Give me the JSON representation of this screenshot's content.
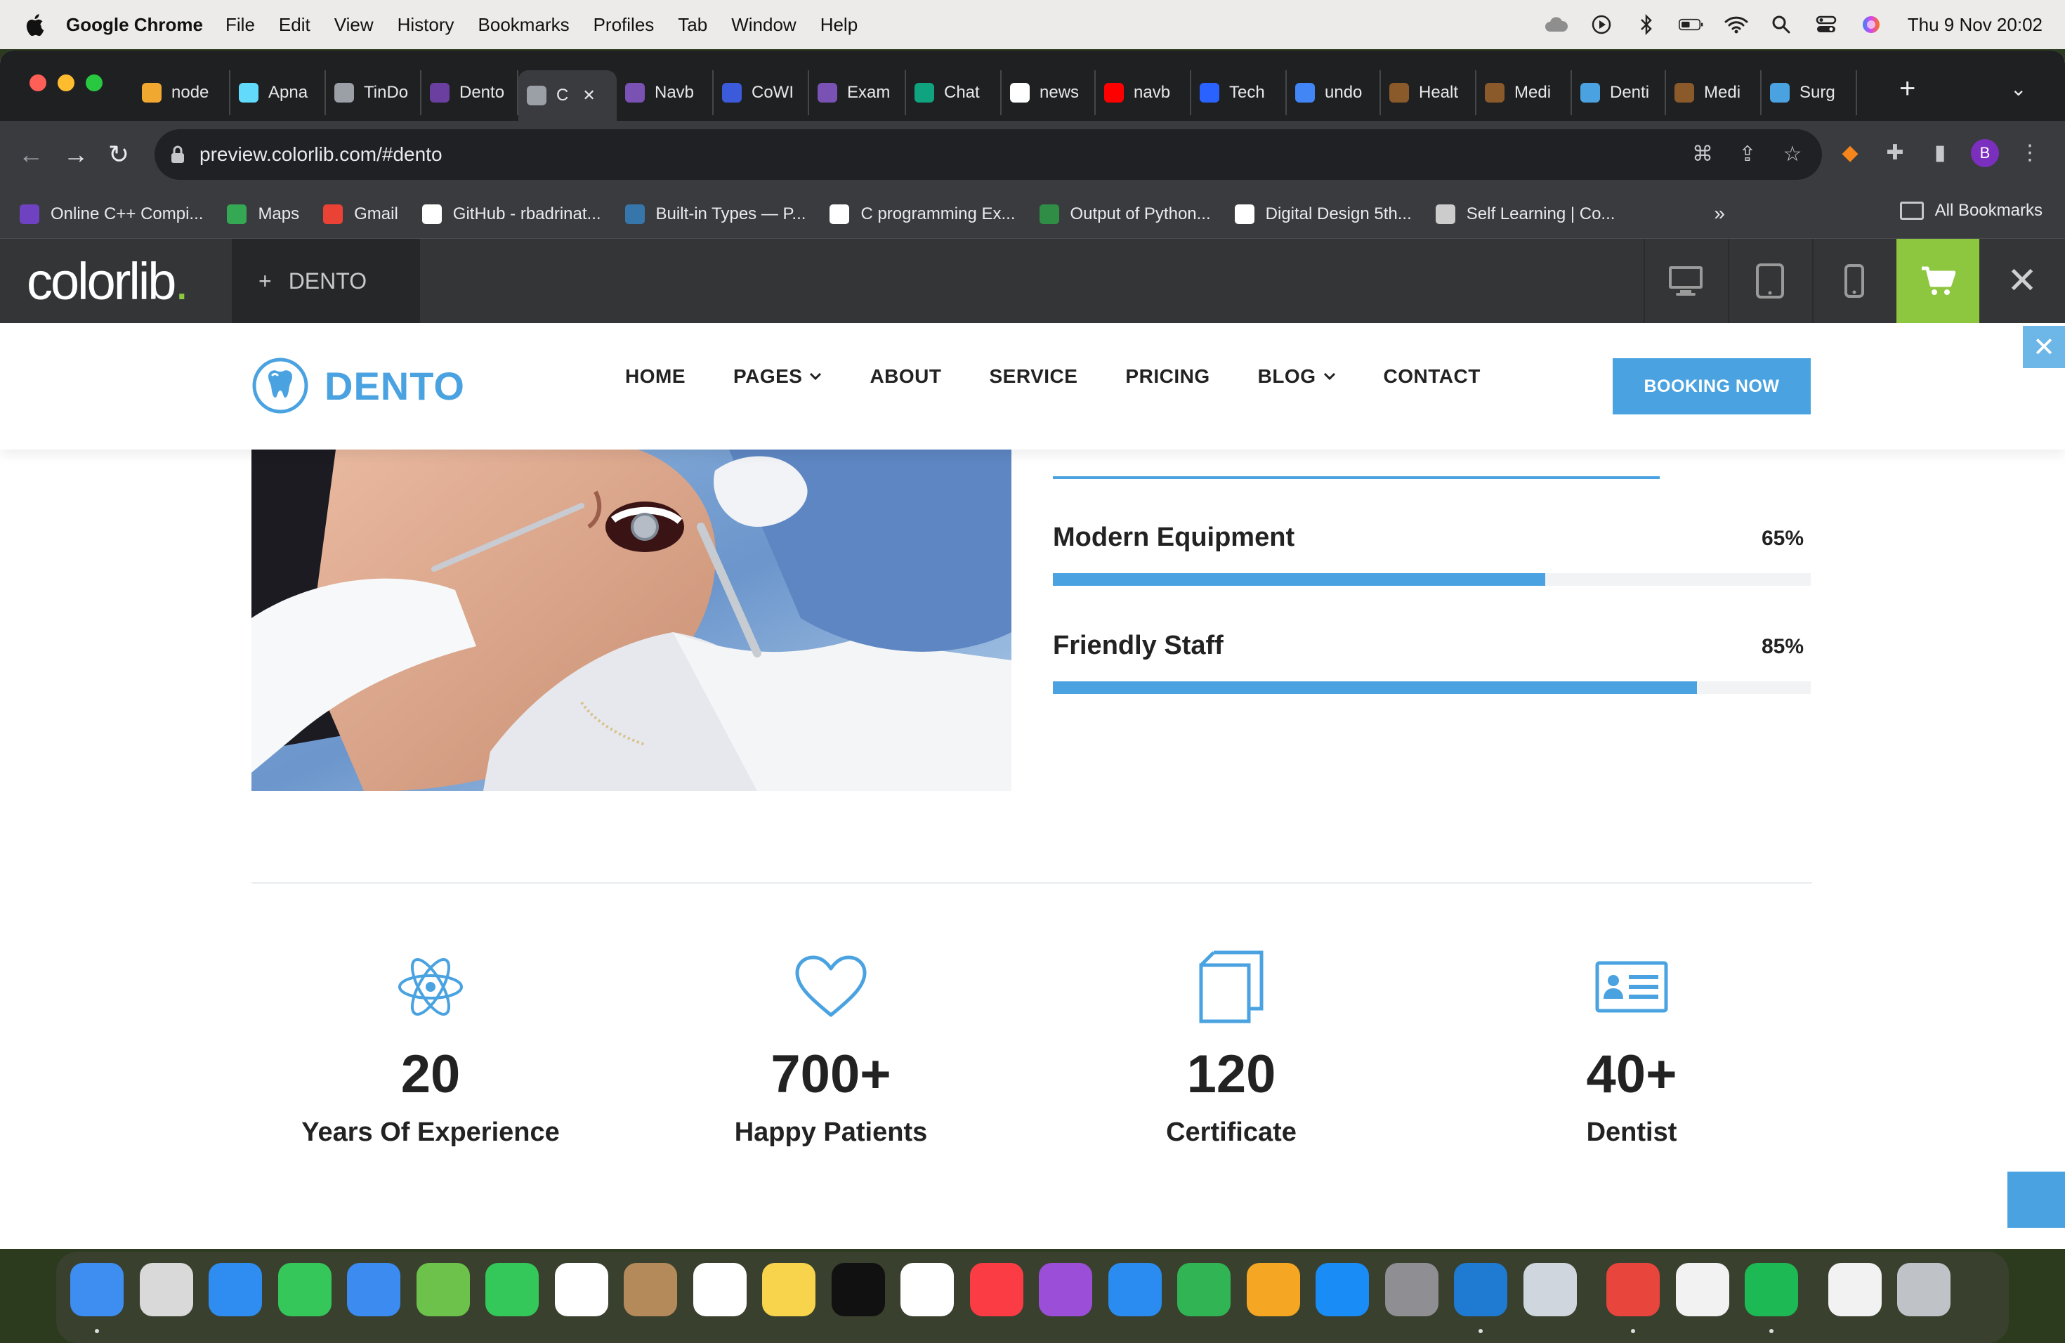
{
  "menubar": {
    "app_name": "Google Chrome",
    "items": [
      "File",
      "Edit",
      "View",
      "History",
      "Bookmarks",
      "Profiles",
      "Tab",
      "Window",
      "Help"
    ],
    "clock": "Thu 9 Nov  20:02"
  },
  "tabs": [
    {
      "title": "node",
      "color": "#f0a830"
    },
    {
      "title": "Apna",
      "color": "#61dafb"
    },
    {
      "title": "TinDo",
      "color": "#9aa0a6"
    },
    {
      "title": "Dento",
      "color": "#6b3fa0"
    },
    {
      "title": "C",
      "color": "#9aa0a6",
      "active": true
    },
    {
      "title": "Navb",
      "color": "#7952b3"
    },
    {
      "title": "CoWI",
      "color": "#3b5bdb"
    },
    {
      "title": "Exam",
      "color": "#7952b3"
    },
    {
      "title": "Chat",
      "color": "#10a37f"
    },
    {
      "title": "news",
      "color": "#ffffff"
    },
    {
      "title": "navb",
      "color": "#ff0000"
    },
    {
      "title": "Tech",
      "color": "#2962ff"
    },
    {
      "title": "undo",
      "color": "#4285f4"
    },
    {
      "title": "Healt",
      "color": "#8b5a2b"
    },
    {
      "title": "Medi",
      "color": "#8b5a2b"
    },
    {
      "title": "Denti",
      "color": "#4aa3e0"
    },
    {
      "title": "Medi",
      "color": "#8b5a2b"
    },
    {
      "title": "Surg",
      "color": "#4aa3e0"
    }
  ],
  "toolbar": {
    "url": "preview.colorlib.com/#dento",
    "avatar_letter": "B"
  },
  "bookmarks": [
    {
      "label": "Online C++ Compi...",
      "color": "#6f42c1"
    },
    {
      "label": "Maps",
      "color": "#34a853"
    },
    {
      "label": "Gmail",
      "color": "#ea4335"
    },
    {
      "label": "GitHub - rbadrinat...",
      "color": "#ffffff"
    },
    {
      "label": "Built-in Types — P...",
      "color": "#3776ab"
    },
    {
      "label": "C programming Ex...",
      "color": "#ffffff"
    },
    {
      "label": "Output of Python...",
      "color": "#2f8d46"
    },
    {
      "label": "Digital Design 5th...",
      "color": "#ffffff"
    },
    {
      "label": "Self Learning | Co...",
      "color": "#cccccc"
    }
  ],
  "bookmarks_more": "»",
  "bookmarks_all": "All Bookmarks",
  "colorlib": {
    "logo_text": "colorlib",
    "logo_dot": ".",
    "project_name": "DENTO",
    "accent": "#8dc63f"
  },
  "site": {
    "brand": "DENTO",
    "accent": "#4aa3e0",
    "nav": [
      {
        "label": "HOME",
        "dropdown": false
      },
      {
        "label": "PAGES",
        "dropdown": true
      },
      {
        "label": "ABOUT",
        "dropdown": false
      },
      {
        "label": "SERVICE",
        "dropdown": false
      },
      {
        "label": "PRICING",
        "dropdown": false
      },
      {
        "label": "BLOG",
        "dropdown": true
      },
      {
        "label": "CONTACT",
        "dropdown": false
      }
    ],
    "booking_label": "BOOKING NOW",
    "skills": [
      {
        "title": "Modern Equipment",
        "percent_label": "65%",
        "percent": 65
      },
      {
        "title": "Friendly Staff",
        "percent_label": "85%",
        "percent": 85
      }
    ],
    "stats": [
      {
        "number": "20",
        "label": "Years Of Experience",
        "icon": "atom-icon"
      },
      {
        "number": "700+",
        "label": "Happy Patients",
        "icon": "heart-icon"
      },
      {
        "number": "120",
        "label": "Certificate",
        "icon": "certificate-icon"
      },
      {
        "number": "40+",
        "label": "Dentist",
        "icon": "id-card-icon"
      }
    ]
  },
  "dock_apps": [
    {
      "name": "finder",
      "color": "#3d8ef0"
    },
    {
      "name": "launchpad",
      "color": "#d9d9d9"
    },
    {
      "name": "safari",
      "color": "#2f8cf0"
    },
    {
      "name": "messages",
      "color": "#35c759"
    },
    {
      "name": "mail",
      "color": "#3b8bf1"
    },
    {
      "name": "maps",
      "color": "#6cc24a"
    },
    {
      "name": "facetime",
      "color": "#34c759"
    },
    {
      "name": "calendar",
      "color": "#ffffff"
    },
    {
      "name": "contacts",
      "color": "#b58a5a"
    },
    {
      "name": "reminders",
      "color": "#ffffff"
    },
    {
      "name": "notes",
      "color": "#f7d44c"
    },
    {
      "name": "tv",
      "color": "#111111"
    },
    {
      "name": "photos",
      "color": "#ffffff"
    },
    {
      "name": "music",
      "color": "#fc3c44"
    },
    {
      "name": "podcasts",
      "color": "#9b4fd8"
    },
    {
      "name": "keynote",
      "color": "#2a8cf0"
    },
    {
      "name": "numbers",
      "color": "#31b454"
    },
    {
      "name": "pages",
      "color": "#f5a623"
    },
    {
      "name": "app-store",
      "color": "#1a8cf5"
    },
    {
      "name": "system-settings",
      "color": "#8e8e93"
    },
    {
      "name": "vscode",
      "color": "#1f7ad2"
    },
    {
      "name": "preview",
      "color": "#cfd6de"
    },
    {
      "name": "chrome",
      "color": "#e8453c"
    },
    {
      "name": "textedit",
      "color": "#f2f2f2"
    },
    {
      "name": "spotify",
      "color": "#1db954"
    },
    {
      "name": "document",
      "color": "#f2f2f2"
    },
    {
      "name": "trash",
      "color": "#bfc3c7"
    }
  ]
}
